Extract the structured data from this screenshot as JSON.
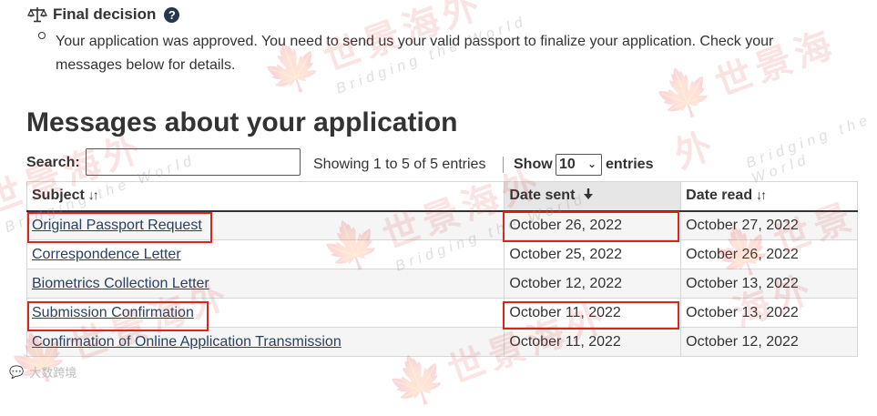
{
  "final_decision": {
    "title": "Final decision",
    "help_icon": "?",
    "text": "Your application was approved. You need to send us your valid passport to finalize your application. Check your messages below for details."
  },
  "messages": {
    "heading": "Messages about your application",
    "search_label": "Search:",
    "search_value": "",
    "showing_text": "Showing 1 to 5 of 5 entries",
    "show_label": "Show",
    "entries_value": "10",
    "entries_label": "entries",
    "columns": [
      {
        "label": "Subject",
        "sort_icon": "↓↑"
      },
      {
        "label": "Date sent",
        "sort_icon": "🡇"
      },
      {
        "label": "Date read",
        "sort_icon": "↓↑"
      }
    ],
    "rows": [
      {
        "subject": "Original Passport Request",
        "date_sent": "October 26, 2022",
        "date_read": "October 27, 2022"
      },
      {
        "subject": "Correspondence Letter",
        "date_sent": "October 25, 2022",
        "date_read": "October 26, 2022"
      },
      {
        "subject": "Biometrics Collection Letter",
        "date_sent": "October 12, 2022",
        "date_read": "October 13, 2022"
      },
      {
        "subject": "Submission Confirmation",
        "date_sent": "October 11, 2022",
        "date_read": "October 13, 2022"
      },
      {
        "subject": "Confirmation of Online Application Transmission",
        "date_sent": "October 11, 2022",
        "date_read": "October 12, 2022"
      }
    ]
  },
  "watermark": {
    "cn": "世景海外",
    "en": "Bridging the World"
  },
  "corner_caption": "大数跨境",
  "colors": {
    "highlight": "#d9251c",
    "link": "#284162",
    "help_bg": "#26374a"
  },
  "icons": [
    "scale-icon",
    "help-icon",
    "sort-icon",
    "sort-desc-icon",
    "chevron-down-icon"
  ]
}
